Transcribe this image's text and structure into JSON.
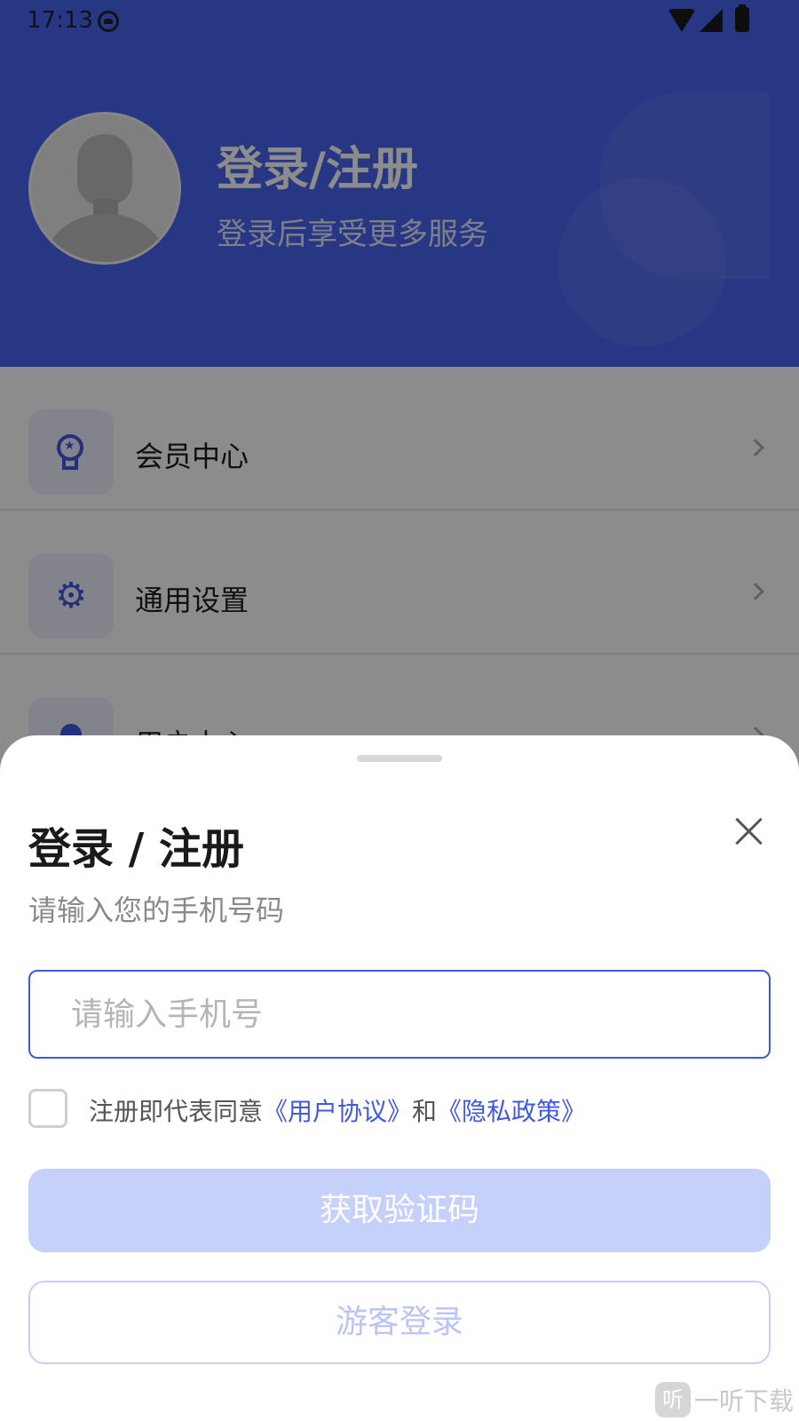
{
  "status_bar": {
    "time": "17:13"
  },
  "profile": {
    "title": "登录/注册",
    "subtitle": "登录后享受更多服务"
  },
  "menu": {
    "items": [
      {
        "label": "会员中心",
        "icon": "medal-icon"
      },
      {
        "label": "通用设置",
        "icon": "gear-icon"
      },
      {
        "label": "用户中心",
        "icon": "user-icon"
      }
    ]
  },
  "sheet": {
    "title": "登录 / 注册",
    "subtitle": "请输入您的手机号码",
    "phone_placeholder": "请输入手机号",
    "agree_prefix": "注册即代表同意",
    "agree_link_terms": "《用户协议》",
    "agree_and": "和",
    "agree_link_privacy": "《隐私政策》",
    "get_code_label": "获取验证码",
    "guest_login_label": "游客登录"
  },
  "colors": {
    "primary": "#3f5ae0",
    "header_bg": "#4a65f0",
    "button_disabled": "#c6d1fb"
  },
  "watermark": {
    "logo": "听",
    "text": "一听下载"
  }
}
